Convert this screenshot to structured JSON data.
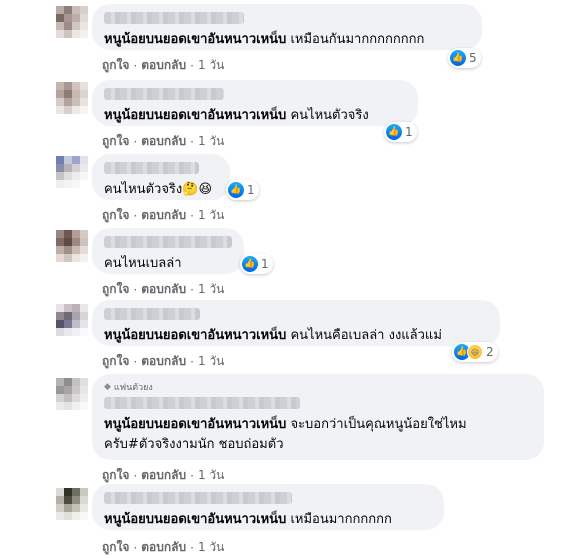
{
  "actions": {
    "like": "ถูกใจ",
    "reply": "ตอบกลับ",
    "sep": "·"
  },
  "colors": {
    "bubble": "#f0f2f5",
    "like_blue": "#1877f2",
    "meta": "#65676b"
  },
  "comments": [
    {
      "tag": "หนูน้อยบนยอดเขาอันหนาวเหน็บ",
      "text": "เหมือนกันมากกกกกกกก",
      "reactions": {
        "types": [
          "like"
        ],
        "count": "5"
      },
      "time": "1 วัน"
    },
    {
      "tag": "หนูน้อยบนยอดเขาอันหนาวเหน็บ",
      "text": "คนไหนตัวจริง",
      "reactions": {
        "types": [
          "like"
        ],
        "count": "1"
      },
      "time": "1 วัน"
    },
    {
      "tag": "",
      "text": "คนไหนตัวจริง🤔😆",
      "reactions": {
        "types": [
          "like"
        ],
        "count": "1"
      },
      "time": "1 วัน"
    },
    {
      "tag": "",
      "text": "คนไหนเบลล่า",
      "reactions": {
        "types": [
          "like"
        ],
        "count": "1"
      },
      "time": "1 วัน"
    },
    {
      "tag": "หนูน้อยบนยอดเขาอันหนาวเหน็บ",
      "text": "คนไหนคือเบลล่า งงแล้วแม่",
      "reactions": {
        "types": [
          "like",
          "haha"
        ],
        "count": "2"
      },
      "time": "1 วัน"
    },
    {
      "badge": "แฟนตัวยง",
      "tag": "หนูน้อยบนยอดเขาอันหนาวเหน็บ",
      "text": "จะบอกว่าเป็นคุณหนูน้อยใช่ไหม",
      "text2": "ครับ#ตัวจริงงามนัก ชอบถ่อมตัว",
      "time": "1 วัน"
    },
    {
      "tag": "หนูน้อยบนยอดเขาอันหนาวเหน็บ",
      "text": "เหมือนมากกกกกก",
      "time": "1 วัน"
    }
  ]
}
